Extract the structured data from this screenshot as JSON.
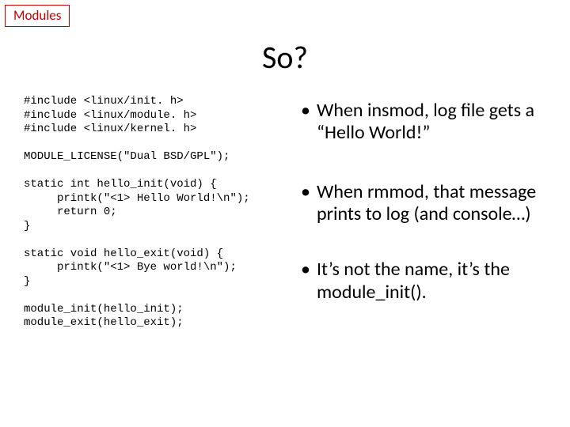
{
  "tag": "Modules",
  "title": "So?",
  "code": "#include <linux/init. h>\n#include <linux/module. h>\n#include <linux/kernel. h>\n\nMODULE_LICENSE(\"Dual BSD/GPL\");\n\nstatic int hello_init(void) {\n     printk(\"<1> Hello World!\\n\");\n     return 0;\n}\n\nstatic void hello_exit(void) {\n     printk(\"<1> Bye world!\\n\");\n}\n\nmodule_init(hello_init);\nmodule_exit(hello_exit);",
  "bullets": [
    "When insmod, log file gets a “Hello World!”",
    "When rmmod, that message prints to log (and console…)",
    "It’s not the name, it’s the module_init()."
  ]
}
